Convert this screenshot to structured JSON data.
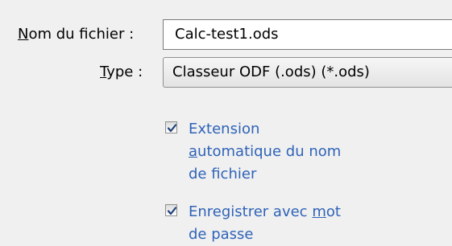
{
  "form": {
    "filename_label_mnemonic": "N",
    "filename_label_rest": "om du fichier :",
    "filename_value": "Calc-test1.ods",
    "type_label_mnemonic": "T",
    "type_label_rest": "ype :",
    "type_selected": "Classeur ODF (.ods) (*.ods)"
  },
  "options": {
    "auto_extension": {
      "checked": true,
      "line1": "Extension",
      "line2_mnemonic": "a",
      "line2_rest": "utomatique du nom",
      "line3": "de fichier"
    },
    "save_with_password": {
      "checked": true,
      "line1_prefix": "Enregistrer avec ",
      "line1_mnemonic": "m",
      "line1_suffix": "ot",
      "line2": "de passe"
    }
  },
  "colors": {
    "background": "#f0f0f0",
    "option_text": "#2f63b8",
    "checkmark": "#1f3f7a"
  }
}
